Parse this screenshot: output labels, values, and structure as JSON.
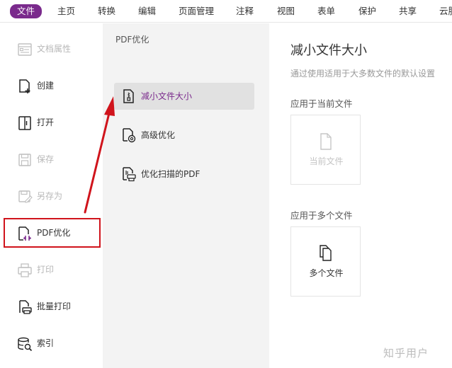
{
  "menubar": {
    "items": [
      "文件",
      "主页",
      "转换",
      "编辑",
      "页面管理",
      "注释",
      "视图",
      "表单",
      "保护",
      "共享",
      "云服"
    ],
    "active_index": 0
  },
  "sidebar": {
    "items": [
      {
        "label": "文档属性",
        "icon": "document-properties-icon",
        "enabled": false
      },
      {
        "label": "创建",
        "icon": "create-document-icon",
        "enabled": true
      },
      {
        "label": "打开",
        "icon": "open-book-icon",
        "enabled": true
      },
      {
        "label": "保存",
        "icon": "save-icon",
        "enabled": false
      },
      {
        "label": "另存为",
        "icon": "save-as-icon",
        "enabled": false
      },
      {
        "label": "PDF优化",
        "icon": "pdf-optimize-icon",
        "enabled": true
      },
      {
        "label": "打印",
        "icon": "printer-icon",
        "enabled": false
      },
      {
        "label": "批量打印",
        "icon": "batch-print-icon",
        "enabled": true
      },
      {
        "label": "索引",
        "icon": "index-database-icon",
        "enabled": true
      }
    ],
    "highlighted": "PDF优化"
  },
  "middle": {
    "title": "PDF优化",
    "items": [
      {
        "label": "减小文件大小",
        "icon": "compress-file-icon",
        "selected": true
      },
      {
        "label": "高级优化",
        "icon": "advanced-optimize-icon",
        "selected": false
      },
      {
        "label": "优化扫描的PDF",
        "icon": "optimize-scanned-pdf-icon",
        "selected": false
      }
    ]
  },
  "right": {
    "title": "减小文件大小",
    "description": "通过使用适用于大多数文件的默认设置",
    "section_current": "应用于当前文件",
    "card_current": "当前文件",
    "section_multiple": "应用于多个文件",
    "card_multiple": "多个文件"
  },
  "watermark": "知乎用户",
  "colors": {
    "accent": "#7a2a8c",
    "annotation_red": "#d0141c",
    "middle_panel_bg": "#f3f3f3"
  }
}
